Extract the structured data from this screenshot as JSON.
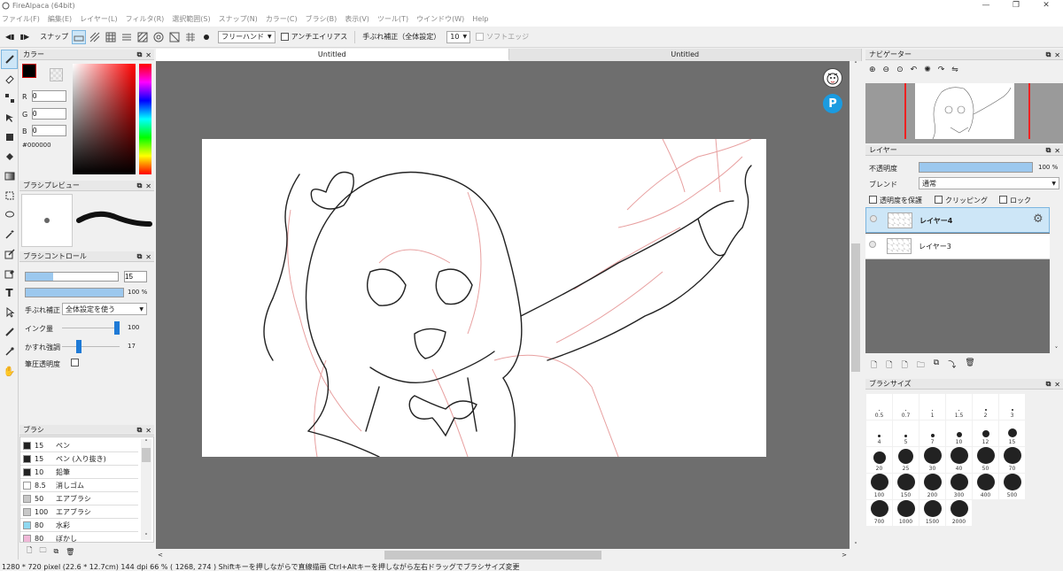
{
  "app": {
    "title": "FireAlpaca (64bit)",
    "icon": "alpaca-icon"
  },
  "menu": [
    "ファイル(F)",
    "編集(E)",
    "レイヤー(L)",
    "フィルタ(R)",
    "選択範囲(S)",
    "スナップ(N)",
    "カラー(C)",
    "ブラシ(B)",
    "表示(V)",
    "ツール(T)",
    "ウインドウ(W)",
    "Help"
  ],
  "toolbar": {
    "snap_label": "スナップ",
    "stroke_mode": "フリーハンド",
    "antialias": "アンチエイリアス",
    "stab_label": "手ぶれ補正（全体設定）",
    "stab_value": "10",
    "soft_edge": "ソフトエッジ"
  },
  "tabs": [
    {
      "label": "Untitled"
    },
    {
      "label": "Untitled"
    }
  ],
  "color_panel": {
    "title": "カラー",
    "r": "0",
    "g": "0",
    "b": "0",
    "hex": "#000000",
    "r_label": "R",
    "g_label": "G",
    "b_label": "B"
  },
  "preview_panel": {
    "title": "ブラシプレビュー"
  },
  "brush_control": {
    "title": "ブラシコントロール",
    "size": "15",
    "opacity": "100 %",
    "stab_label": "手ぶれ補正",
    "stab_value": "全体設定を使う",
    "ink_label": "インク量",
    "ink_value": "100",
    "fade_label": "かすれ強調",
    "fade_value": "17",
    "pressure_label": "筆圧透明度"
  },
  "brush_panel": {
    "title": "ブラシ",
    "items": [
      {
        "size": "15",
        "name": "ペン",
        "color": "#222222"
      },
      {
        "size": "15",
        "name": "ペン (入り抜き)",
        "color": "#222222"
      },
      {
        "size": "10",
        "name": "鉛筆",
        "color": "#222222"
      },
      {
        "size": "8.5",
        "name": "消しゴム",
        "color": "#ffffff"
      },
      {
        "size": "50",
        "name": "エアブラシ",
        "color": "#c8c8c8"
      },
      {
        "size": "100",
        "name": "エアブラシ",
        "color": "#c8c8c8"
      },
      {
        "size": "80",
        "name": "水彩",
        "color": "#8fd8f0"
      },
      {
        "size": "80",
        "name": "ぼかし",
        "color": "#f0b8d8"
      }
    ]
  },
  "navigator": {
    "title": "ナビゲーター"
  },
  "layer_panel": {
    "title": "レイヤー",
    "opacity_label": "不透明度",
    "opacity_value": "100 %",
    "blend_label": "ブレンド",
    "blend_value": "通常",
    "protect": "透明度を保護",
    "clip": "クリッピング",
    "lock": "ロック",
    "layers": [
      {
        "name": "レイヤー4"
      },
      {
        "name": "レイヤー3"
      }
    ]
  },
  "brush_size_panel": {
    "title": "ブラシサイズ",
    "sizes": [
      {
        "label": "0.5",
        "d": 1
      },
      {
        "label": "0.7",
        "d": 1
      },
      {
        "label": "1",
        "d": 1
      },
      {
        "label": "1.5",
        "d": 1
      },
      {
        "label": "2",
        "d": 2
      },
      {
        "label": "3",
        "d": 2
      },
      {
        "label": "4",
        "d": 3
      },
      {
        "label": "5",
        "d": 3
      },
      {
        "label": "7",
        "d": 4
      },
      {
        "label": "10",
        "d": 6
      },
      {
        "label": "12",
        "d": 8
      },
      {
        "label": "15",
        "d": 10
      },
      {
        "label": "20",
        "d": 14
      },
      {
        "label": "25",
        "d": 17
      },
      {
        "label": "30",
        "d": 20
      },
      {
        "label": "40",
        "d": 20
      },
      {
        "label": "50",
        "d": 20
      },
      {
        "label": "70",
        "d": 20
      },
      {
        "label": "100",
        "d": 20
      },
      {
        "label": "150",
        "d": 20
      },
      {
        "label": "200",
        "d": 20
      },
      {
        "label": "300",
        "d": 20
      },
      {
        "label": "400",
        "d": 20
      },
      {
        "label": "500",
        "d": 20
      },
      {
        "label": "700",
        "d": 20
      },
      {
        "label": "1000",
        "d": 20
      },
      {
        "label": "1500",
        "d": 20
      },
      {
        "label": "2000",
        "d": 20
      }
    ]
  },
  "status": "1280 * 720 pixel  (22.6 * 12.7cm)  144 dpi  66 %  ( 1268, 274 )  Shiftキーを押しながらで直線描画  Ctrl+Altキーを押しながら左右ドラッグでブラシサイズ変更"
}
